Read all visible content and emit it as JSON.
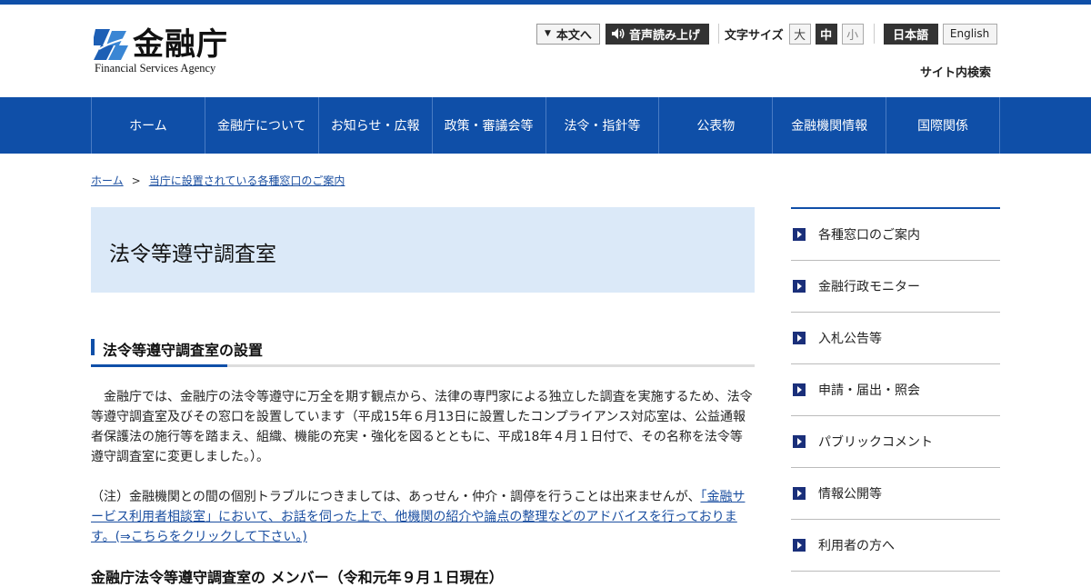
{
  "header": {
    "logo_text": "金融庁",
    "logo_sub": "Financial Services Agency",
    "skip_label": "本文へ",
    "voice_label": "音声読み上げ",
    "font_size_label": "文字サイズ",
    "font_sizes": [
      "大",
      "中",
      "小"
    ],
    "lang_ja": "日本語",
    "lang_en": "English",
    "site_search": "サイト内検索"
  },
  "nav": {
    "items": [
      "ホーム",
      "金融庁について",
      "お知らせ・広報",
      "政策・審議会等",
      "法令・指針等",
      "公表物",
      "金融機関情報",
      "国際関係"
    ]
  },
  "breadcrumb": {
    "home": "ホーム",
    "separator": ">",
    "current": "当庁に設置されている各種窓口のご案内"
  },
  "page_title": "法令等遵守調査室",
  "section": {
    "heading": "法令等遵守調査室の設置",
    "para1": "金融庁では、金融庁の法令等遵守に万全を期す観点から、法律の専門家による独立した調査を実施するため、法令等遵守調査室及びその窓口を設置しています（平成15年６月13日に設置したコンプライアンス対応室は、公益通報者保護法の施行等を踏まえ、組織、機能の充実・強化を図るとともに、平成18年４月１日付で、その名称を法令等遵守調査室に変更しました。）。",
    "para2_prefix": "（注）金融機関との間の個別トラブルにつきましては、あっせん・仲介・調停を行うことは出来ませんが、",
    "para2_link": "「金融サービス利用者相談室」において、お話を伺った上で、他機関の紹介や論点の整理などのアドバイスを行っております。(⇒こちらをクリックして下さい。)",
    "next_heading": "金融庁法令等遵守調査室の メンバー（令和元年９月１日現在）"
  },
  "sidebar": {
    "items": [
      "各種窓口のご案内",
      "金融行政モニター",
      "入札公告等",
      "申請・届出・照会",
      "パブリックコメント",
      "情報公開等",
      "利用者の方へ"
    ]
  },
  "colors": {
    "brand_blue": "#0f4fa8",
    "title_bg": "#dbe9f8",
    "link": "#1a4ea0"
  }
}
